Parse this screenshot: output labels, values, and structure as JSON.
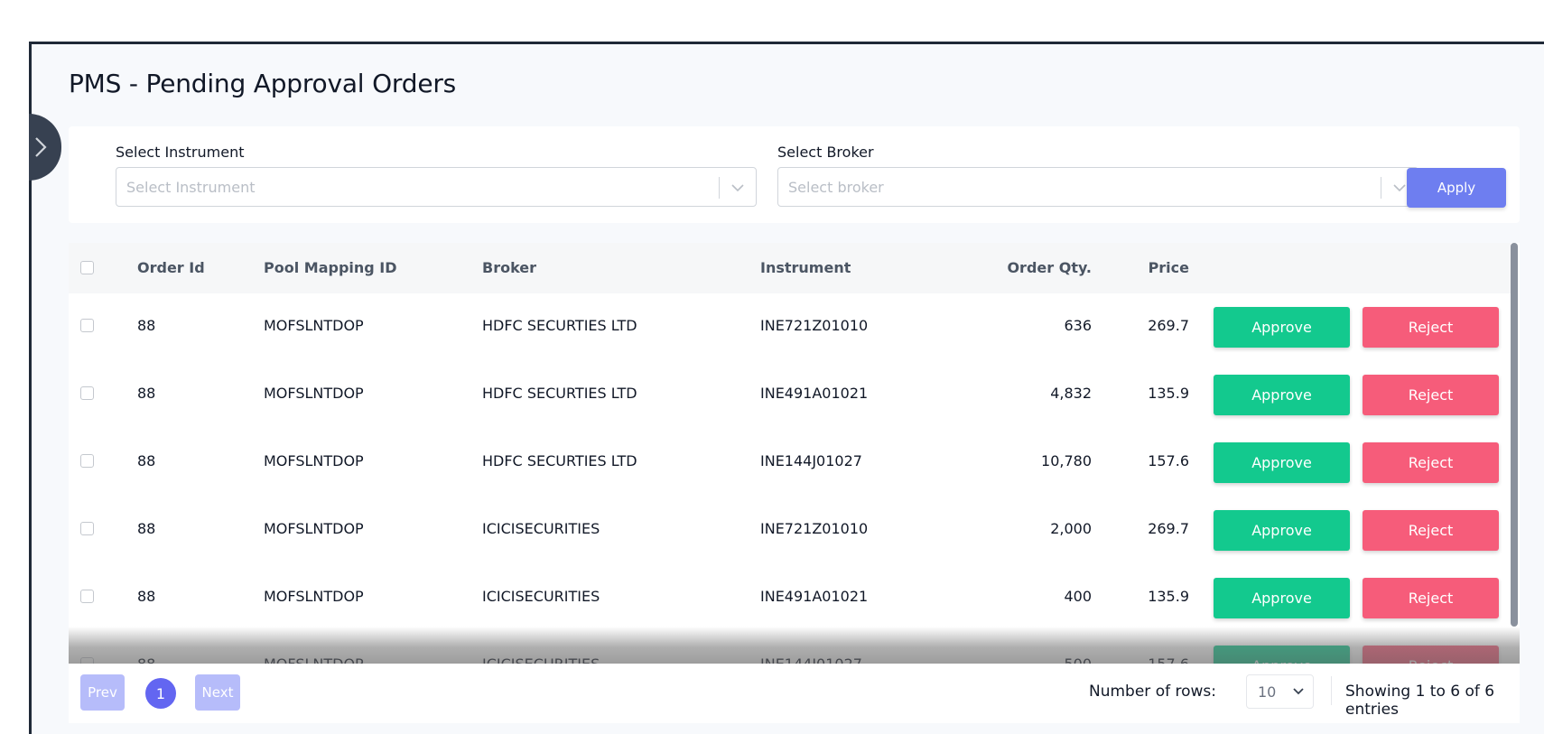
{
  "page": {
    "title": "PMS - Pending Approval Orders"
  },
  "filters": {
    "instrument": {
      "label": "Select Instrument",
      "placeholder": "Select Instrument"
    },
    "broker": {
      "label": "Select Broker",
      "placeholder": "Select broker"
    },
    "apply_label": "Apply"
  },
  "table": {
    "headers": {
      "order_id": "Order Id",
      "pool_mapping_id": "Pool Mapping ID",
      "broker": "Broker",
      "instrument": "Instrument",
      "order_qty": "Order Qty.",
      "price": "Price"
    },
    "approve_label": "Approve",
    "reject_label": "Reject",
    "rows": [
      {
        "order_id": "88",
        "pool_mapping_id": "MOFSLNTDOP",
        "broker": "HDFC SECURTIES LTD",
        "instrument": "INE721Z01010",
        "order_qty": "636",
        "price": "269.7"
      },
      {
        "order_id": "88",
        "pool_mapping_id": "MOFSLNTDOP",
        "broker": "HDFC SECURTIES LTD",
        "instrument": "INE491A01021",
        "order_qty": "4,832",
        "price": "135.9"
      },
      {
        "order_id": "88",
        "pool_mapping_id": "MOFSLNTDOP",
        "broker": "HDFC SECURTIES LTD",
        "instrument": "INE144J01027",
        "order_qty": "10,780",
        "price": "157.6"
      },
      {
        "order_id": "88",
        "pool_mapping_id": "MOFSLNTDOP",
        "broker": "ICICISECURITIES",
        "instrument": "INE721Z01010",
        "order_qty": "2,000",
        "price": "269.7"
      },
      {
        "order_id": "88",
        "pool_mapping_id": "MOFSLNTDOP",
        "broker": "ICICISECURITIES",
        "instrument": "INE491A01021",
        "order_qty": "400",
        "price": "135.9"
      },
      {
        "order_id": "88",
        "pool_mapping_id": "MOFSLNTDOP",
        "broker": "ICICISECURITIES",
        "instrument": "INE144J01027",
        "order_qty": "500",
        "price": "157.6"
      }
    ]
  },
  "pagination": {
    "prev_label": "Prev",
    "current_page": "1",
    "next_label": "Next",
    "rows_label": "Number of rows:",
    "rows_value": "10",
    "showing_text": "Showing 1 to 6 of 6 entries"
  },
  "colors": {
    "approve": "#13c98e",
    "reject": "#f65c7a",
    "primary": "#6e7ef0",
    "sidebar": "#374151"
  }
}
